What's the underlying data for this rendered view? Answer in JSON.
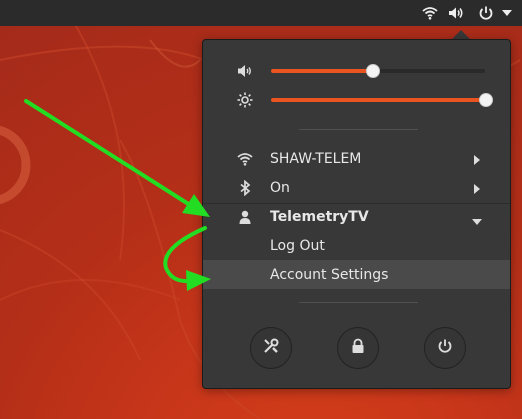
{
  "menu": {
    "network_label": "SHAW-TELEM",
    "bluetooth_label": "On",
    "user_label": "TelemetryTV",
    "logout_label": "Log Out",
    "account_settings_label": "Account Settings"
  },
  "sliders": {
    "volume_level": 0.47,
    "brightness_level": 1.0
  },
  "icons": {
    "topbar": [
      "wifi-icon",
      "volume-icon",
      "power-icon",
      "chevron-down-icon"
    ],
    "buttons": [
      "settings-icon",
      "lock-icon",
      "power-off-icon"
    ]
  },
  "colors": {
    "accent": "#e95420",
    "menu_bg": "#383838",
    "annotation": "#22dd22"
  }
}
